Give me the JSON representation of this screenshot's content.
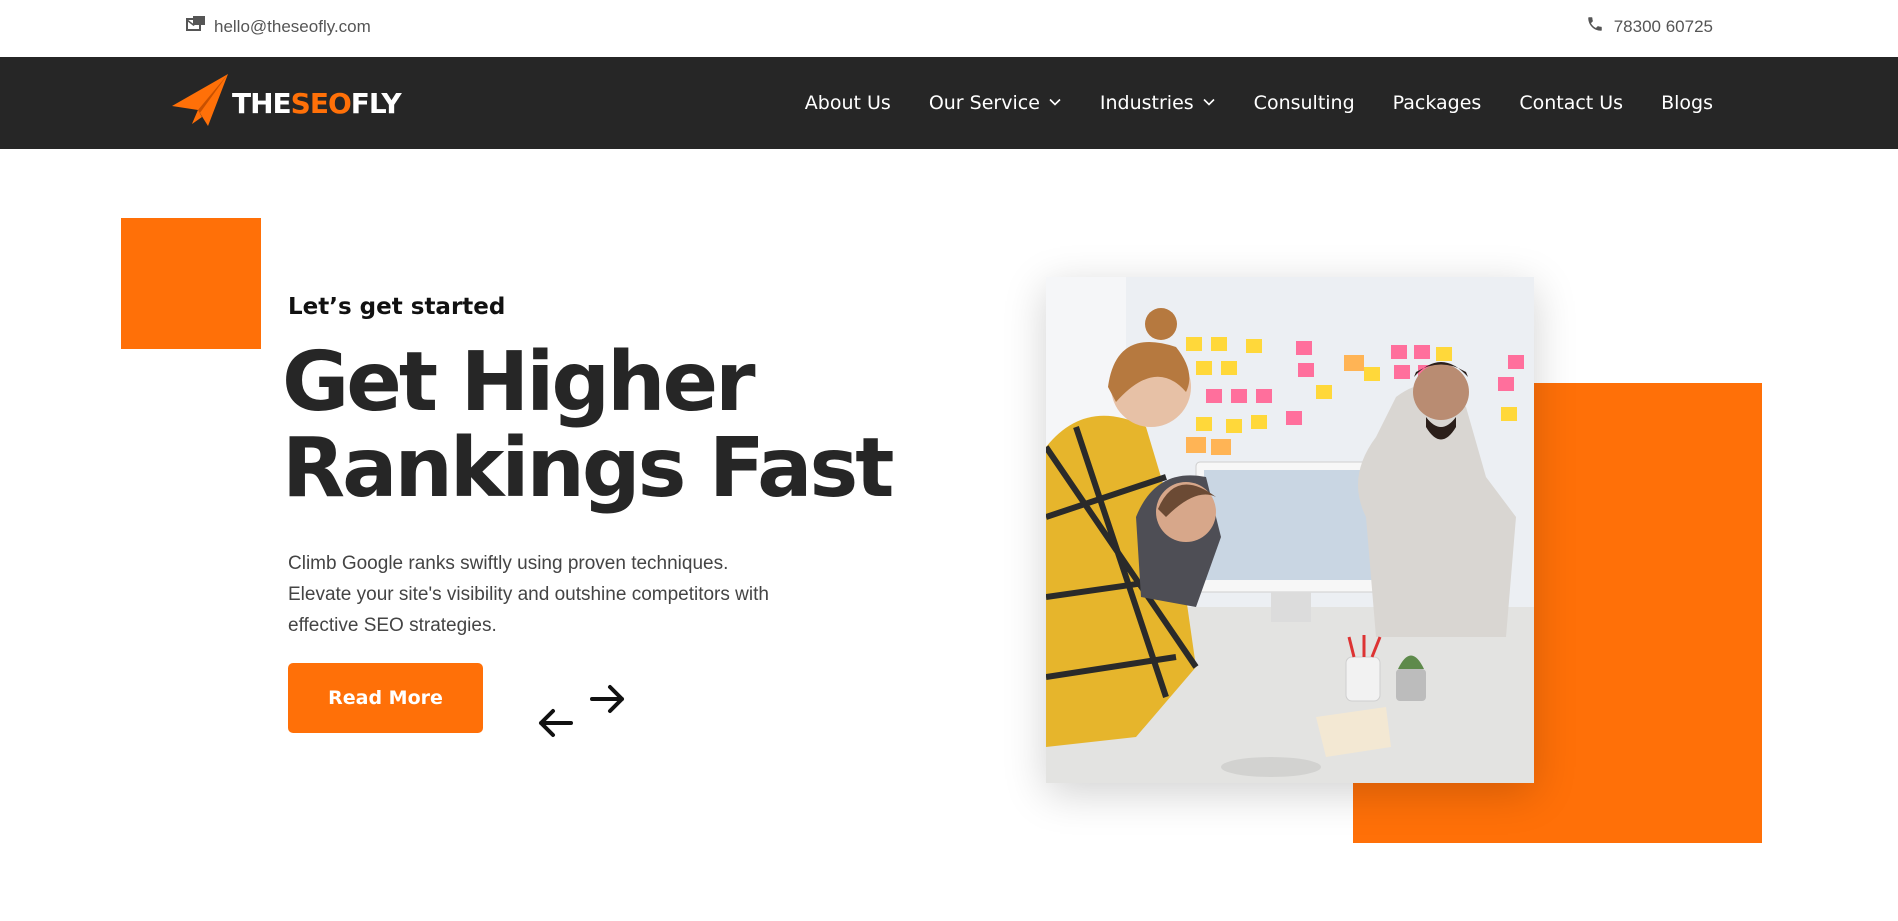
{
  "topbar": {
    "email": "hello@theseofly.com",
    "phone": "78300 60725"
  },
  "brand": {
    "logo_text_white_1": "THE",
    "logo_text_accent": "SEO",
    "logo_text_white_2": "FLY",
    "accent_color": "#ff7008",
    "nav_bg": "#262626"
  },
  "nav": {
    "items": [
      {
        "label": "About Us"
      },
      {
        "label": "Our Service"
      },
      {
        "label": "Industries"
      },
      {
        "label": "Consulting"
      },
      {
        "label": "Packages"
      },
      {
        "label": "Contact Us"
      },
      {
        "label": "Blogs"
      }
    ]
  },
  "hero": {
    "eyebrow": "Let’s get started",
    "headline_line1": "Get Higher",
    "headline_line2": "Rankings Fast",
    "description": "Climb Google ranks swiftly using proven techniques. Elevate your site's visibility and outshine competitors with effective SEO strategies.",
    "cta_label": "Read More"
  },
  "icons": {
    "email": "email-icon",
    "phone": "phone-icon",
    "dropdown": "chevron-down-icon",
    "prev": "arrow-left-icon",
    "next": "arrow-right-icon"
  }
}
